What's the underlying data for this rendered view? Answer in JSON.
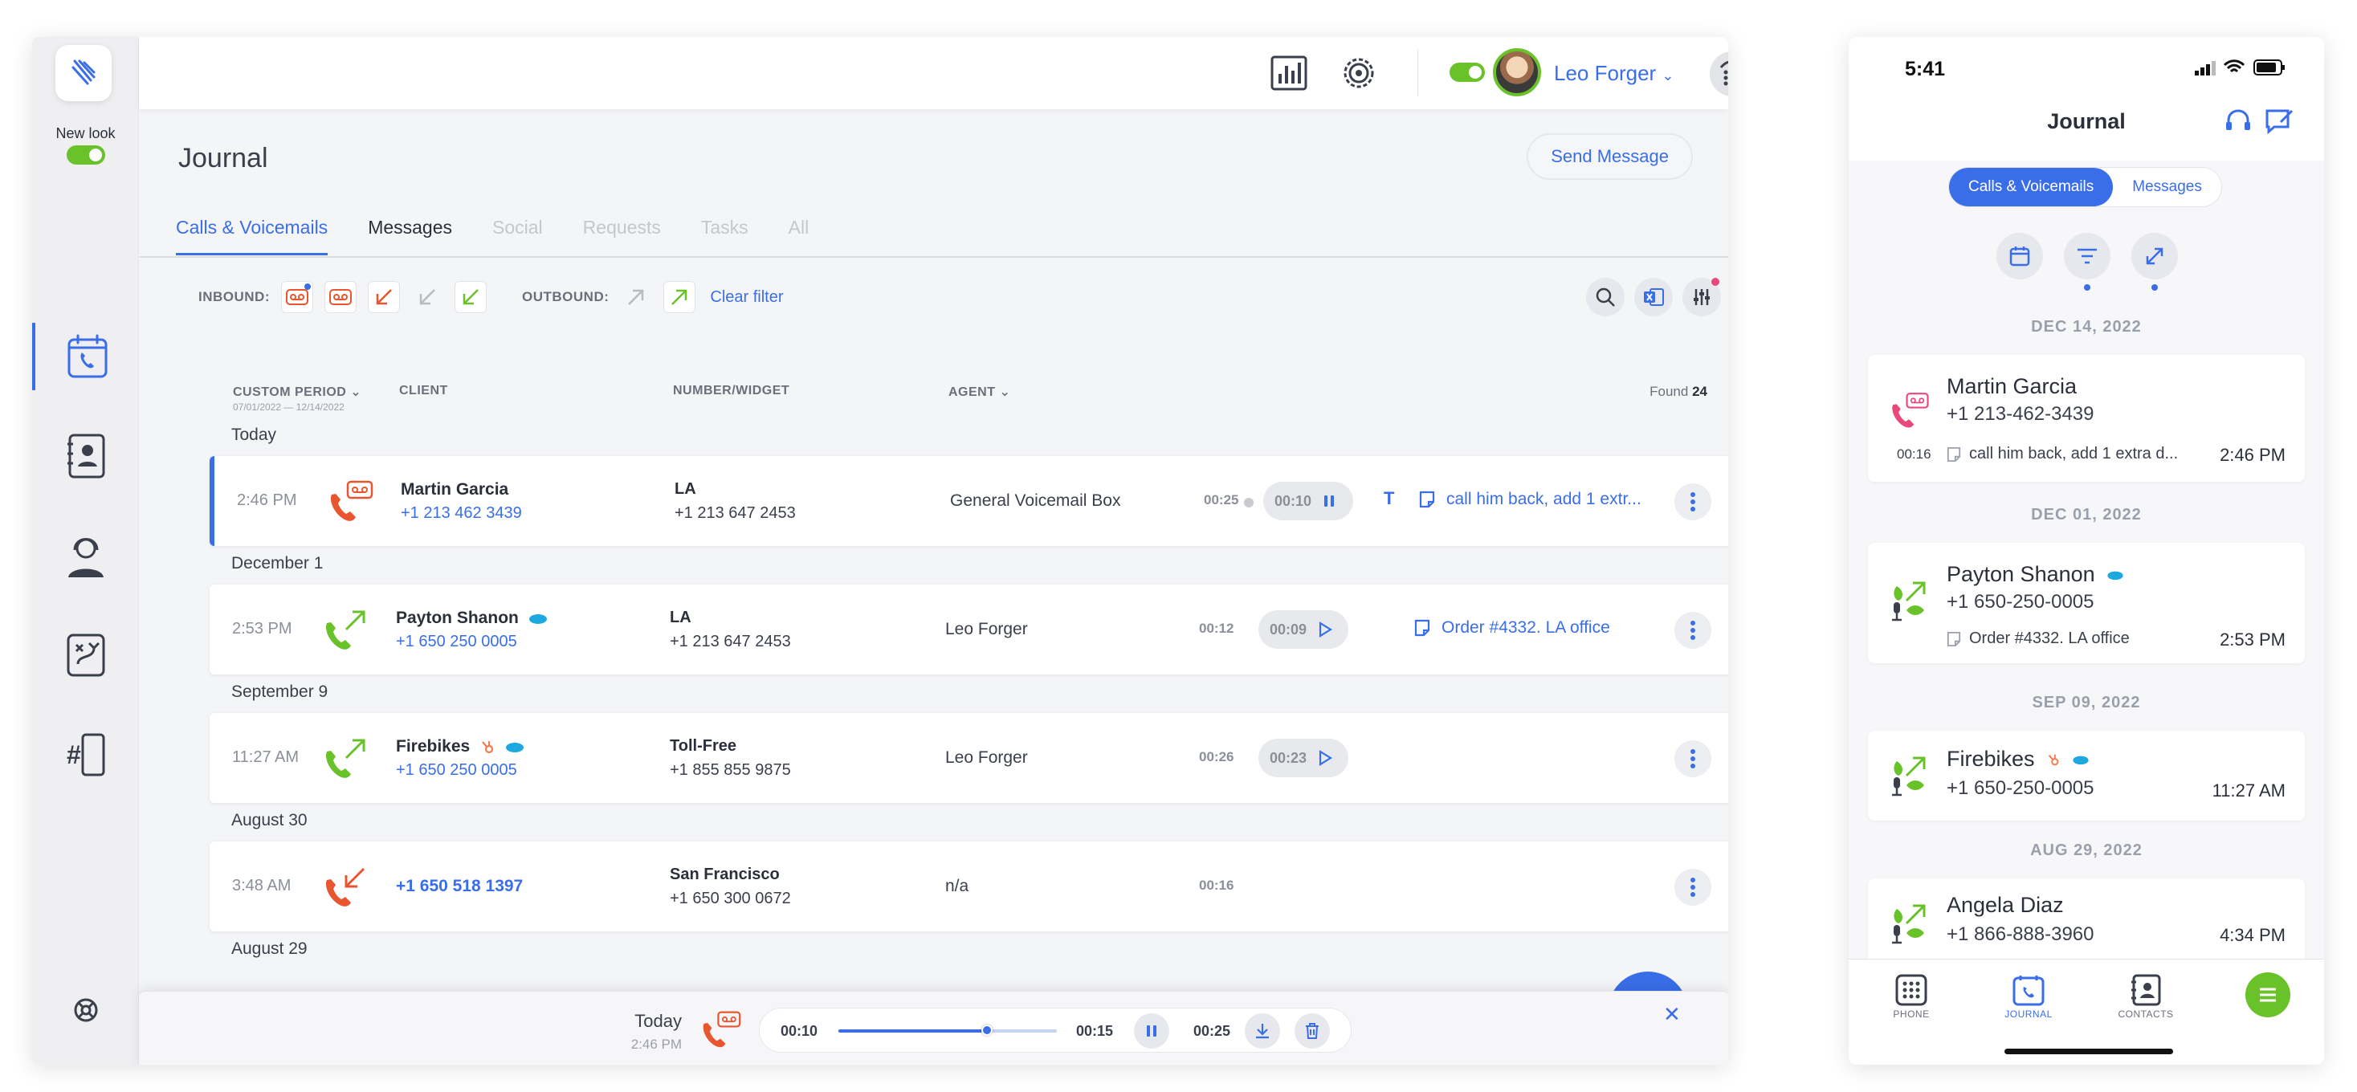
{
  "sidebar": {
    "new_look_label": "New look"
  },
  "topbar": {
    "user_name": "Leo Forger"
  },
  "page": {
    "title": "Journal",
    "send_message": "Send Message"
  },
  "tabs": [
    "Calls & Voicemails",
    "Messages",
    "Social",
    "Requests",
    "Tasks",
    "All"
  ],
  "filters": {
    "inbound_label": "INBOUND:",
    "outbound_label": "OUTBOUND:",
    "clear": "Clear filter"
  },
  "columns": {
    "period": "CUSTOM PERIOD",
    "period_range": "07/01/2022 — 12/14/2022",
    "client": "CLIENT",
    "number": "NUMBER/WIDGET",
    "agent": "AGENT",
    "found_label": "Found",
    "found_count": "24"
  },
  "groups": [
    "Today",
    "December 1",
    "September 9",
    "August 30",
    "August 29"
  ],
  "rows": [
    {
      "time": "2:46 PM",
      "client": "Martin Garcia",
      "client_number": "+1 213 462 3439",
      "widget": "LA",
      "widget_number": "+1 213 647 2453",
      "agent": "General Voicemail Box",
      "duration": "00:25",
      "play_time": "00:10",
      "note": "call him back, add 1 extr...",
      "transcript": "T"
    },
    {
      "time": "2:53 PM",
      "client": "Payton Shanon",
      "client_number": "+1 650 250 0005",
      "widget": "LA",
      "widget_number": "+1 213 647 2453",
      "agent": "Leo Forger",
      "duration": "00:12",
      "play_time": "00:09",
      "note": "Order #4332. LA office"
    },
    {
      "time": "11:27 AM",
      "client": "Firebikes",
      "client_number": "+1 650 250 0005",
      "widget": "Toll-Free",
      "widget_number": "+1 855 855 9875",
      "agent": "Leo Forger",
      "duration": "00:26",
      "play_time": "00:23"
    },
    {
      "time": "3:48 AM",
      "client_number": "+1 650 518 1397",
      "widget": "San Francisco",
      "widget_number": "+1 650 300 0672",
      "agent": "n/a",
      "duration": "00:16"
    }
  ],
  "player": {
    "day": "Today",
    "time": "2:46 PM",
    "elapsed": "00:10",
    "marker": "00:15",
    "total": "00:25",
    "progress": 0.68
  },
  "mobile": {
    "clock": "5:41",
    "title": "Journal",
    "segments": [
      "Calls & Voicemails",
      "Messages"
    ],
    "dates": [
      "DEC 14, 2022",
      "DEC 01, 2022",
      "SEP 09, 2022",
      "AUG 29, 2022"
    ],
    "cards": [
      {
        "name": "Martin Garcia",
        "number": "+1 213-462-3439",
        "duration": "00:16",
        "note": "call him back, add 1 extra d...",
        "time": "2:46 PM"
      },
      {
        "name": "Payton Shanon",
        "number": "+1 650-250-0005",
        "note": "Order #4332. LA office",
        "time": "2:53 PM"
      },
      {
        "name": "Firebikes",
        "number": "+1 650-250-0005",
        "time": "11:27 AM"
      },
      {
        "name": "Angela Diaz",
        "number": "+1 866-888-3960",
        "time": "4:34 PM"
      }
    ],
    "tabbar": [
      "PHONE",
      "JOURNAL",
      "CONTACTS"
    ]
  },
  "colors": {
    "accent": "#3a6ee8",
    "green": "#6ac22a",
    "red": "#e8552e",
    "pink": "#e8487a"
  }
}
